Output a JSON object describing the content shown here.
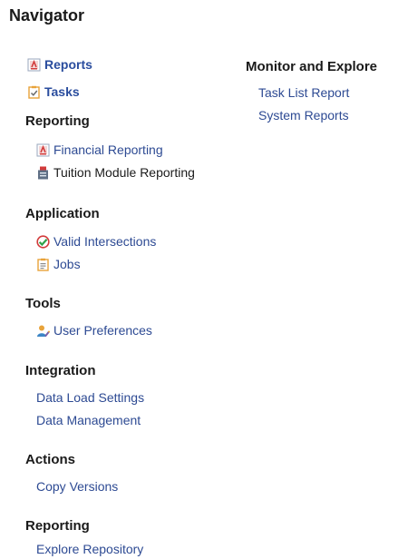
{
  "header": {
    "title": "Navigator"
  },
  "top_links": [
    {
      "label": "Reports",
      "icon": "report-icon"
    },
    {
      "label": "Tasks",
      "icon": "tasks-icon"
    }
  ],
  "monitor": {
    "heading": "Monitor and Explore",
    "items": [
      {
        "label": "Task List Report"
      },
      {
        "label": "System Reports"
      }
    ]
  },
  "reporting1": {
    "heading": "Reporting",
    "items": [
      {
        "label": "Financial Reporting",
        "icon": "report-icon"
      },
      {
        "label": "Tuition Module Reporting",
        "icon": "module-icon"
      }
    ]
  },
  "application": {
    "heading": "Application",
    "items": [
      {
        "label": "Valid Intersections",
        "icon": "valid-intersections-icon"
      },
      {
        "label": "Jobs",
        "icon": "jobs-icon"
      }
    ]
  },
  "tools": {
    "heading": "Tools",
    "items": [
      {
        "label": "User Preferences",
        "icon": "user-preferences-icon"
      }
    ]
  },
  "integration": {
    "heading": "Integration",
    "items": [
      {
        "label": "Data Load Settings"
      },
      {
        "label": "Data Management"
      }
    ]
  },
  "actions": {
    "heading": "Actions",
    "items": [
      {
        "label": "Copy Versions"
      }
    ]
  },
  "reporting2": {
    "heading": "Reporting",
    "items": [
      {
        "label": "Explore Repository"
      }
    ]
  },
  "colors": {
    "link": "#2d4a93",
    "heading": "#1a1a1a",
    "accent_red": "#d23b3b",
    "accent_orange": "#e8a33a"
  }
}
